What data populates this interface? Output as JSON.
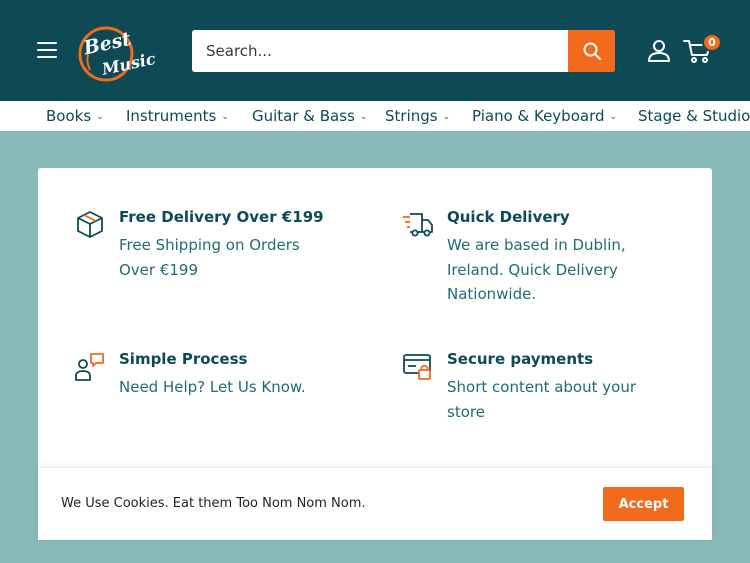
{
  "header": {
    "logo_line1": "Best",
    "logo_line2": "Music",
    "search_placeholder": "Search...",
    "cart_count": "0"
  },
  "nav": {
    "items": [
      {
        "label": "Books"
      },
      {
        "label": "Instruments"
      },
      {
        "label": "Guitar & Bass"
      },
      {
        "label": "Strings"
      },
      {
        "label": "Piano & Keyboard"
      },
      {
        "label": "Stage & Studio"
      }
    ]
  },
  "features": [
    {
      "icon": "package-icon",
      "title": "Free Delivery Over €199",
      "desc": [
        "Free Shipping on Orders",
        "Over €199"
      ]
    },
    {
      "icon": "delivery-truck-icon",
      "title": "Quick Delivery",
      "desc": [
        "We are based in Dublin,",
        "Ireland. Quick Delivery",
        "Nationwide."
      ]
    },
    {
      "icon": "support-chat-icon",
      "title": "Simple Process",
      "desc": [
        "Need Help? Let Us Know."
      ]
    },
    {
      "icon": "secure-payment-icon",
      "title": "Secure payments",
      "desc": [
        "Short content about your",
        "store"
      ]
    }
  ],
  "cookie": {
    "text": "We Use Cookies. Eat them Too Nom Nom Nom.",
    "accept_label": "Accept"
  },
  "colors": {
    "header_bg": "#0d4a55",
    "accent": "#f26a1b",
    "page_bg": "#86b9b8",
    "text_dark": "#0d4a55",
    "text_desc": "#1d6d73"
  }
}
